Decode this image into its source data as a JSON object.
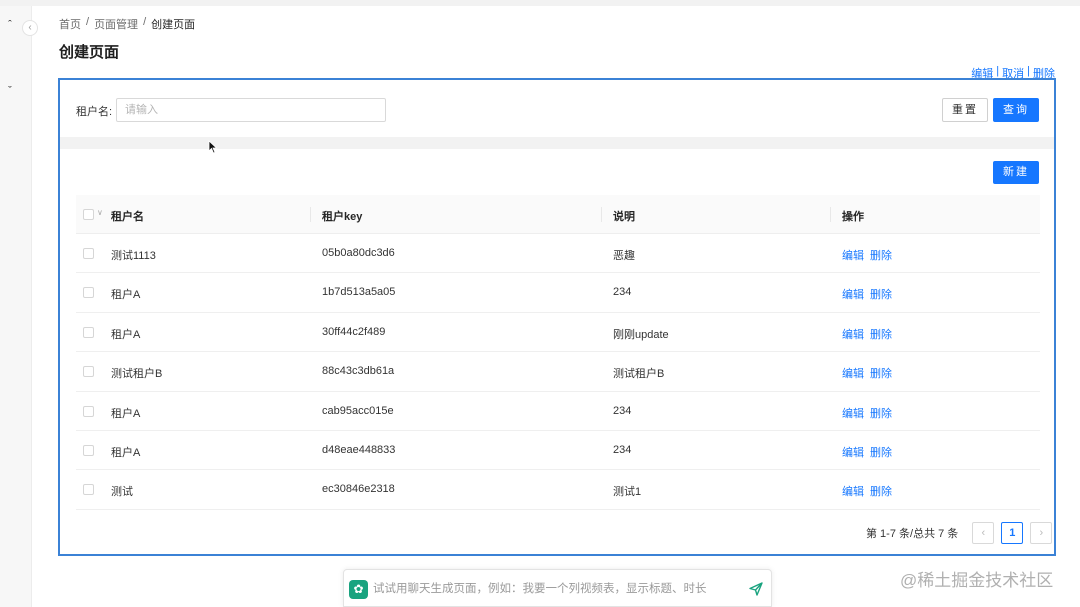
{
  "breadcrumb": [
    "首页",
    "页面管理",
    "创建页面"
  ],
  "breadcrumb_separator": "/",
  "page_title": "创建页面",
  "edit_links": {
    "edit": "编辑",
    "cancel": "取消",
    "delete": "删除",
    "separator": "|"
  },
  "filter": {
    "label": "租户名:",
    "placeholder": "请输入",
    "value": "",
    "reset_label": "重置",
    "query_label": "查询"
  },
  "new_button_label": "新建",
  "table": {
    "columns": [
      "租户名",
      "租户key",
      "说明",
      "操作"
    ],
    "rows": [
      {
        "name": "测试1113",
        "key": "05b0a80dc3d6",
        "desc": "恶趣"
      },
      {
        "name": "租户A",
        "key": "1b7d513a5a05",
        "desc": "234"
      },
      {
        "name": "租户A",
        "key": "30ff44c2f489",
        "desc": "刚刚update"
      },
      {
        "name": "测试租户B",
        "key": "88c43c3db61a",
        "desc": "测试租户B"
      },
      {
        "name": "租户A",
        "key": "cab95acc015e",
        "desc": "234"
      },
      {
        "name": "租户A",
        "key": "d48eae448833",
        "desc": "234"
      },
      {
        "name": "测试",
        "key": "ec30846e2318",
        "desc": "测试1"
      }
    ],
    "row_actions": {
      "edit": "编辑",
      "delete": "删除"
    }
  },
  "pagination": {
    "total_text": "第 1-7 条/总共 7 条",
    "prev": "‹",
    "current_page": "1",
    "next": "›"
  },
  "chat": {
    "placeholder": "试试用聊天生成页面，例如：我要一个列视频表，显示标题、时长"
  },
  "watermark": "@稀土掘金技术社区",
  "colors": {
    "primary": "#1677ff",
    "frame_border": "#3b82d6",
    "chat_logo": "#19a37f"
  }
}
